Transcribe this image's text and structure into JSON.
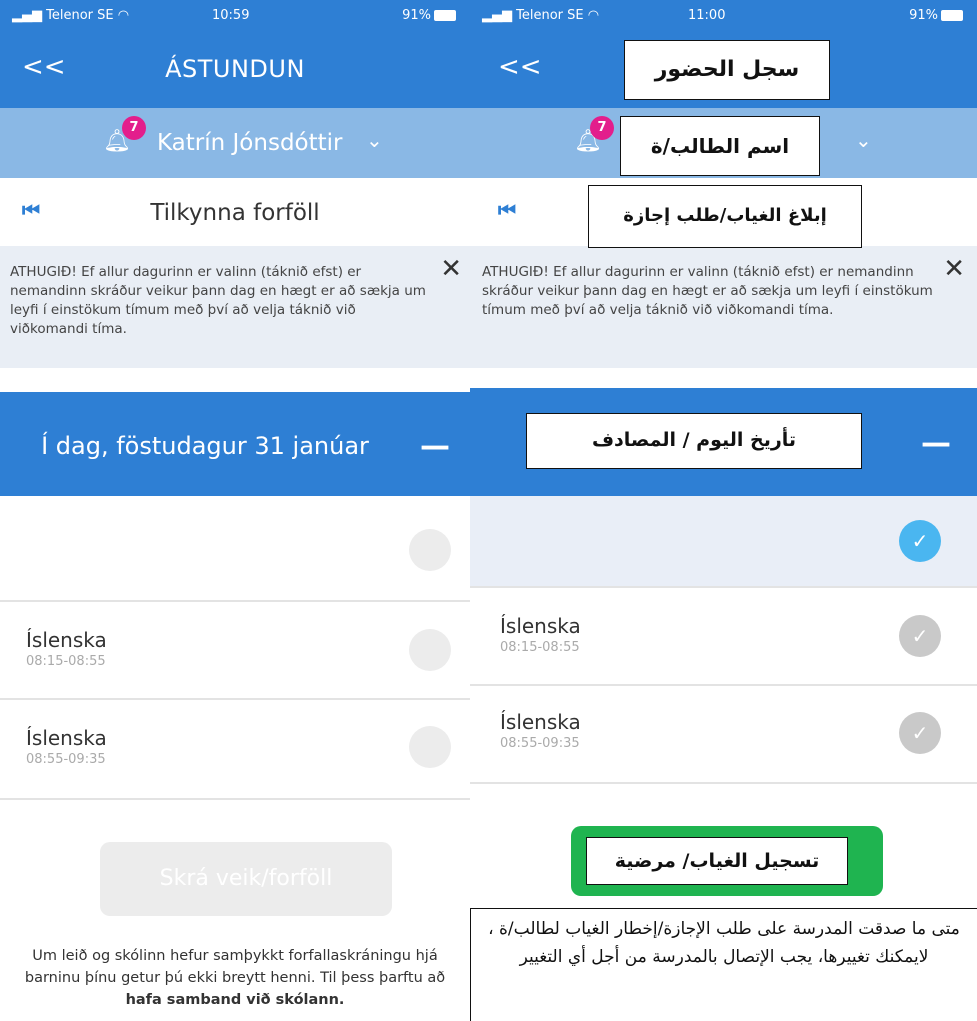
{
  "left": {
    "status": {
      "carrier": "Telenor SE",
      "time": "10:59",
      "battery": "91%"
    },
    "header": {
      "back": "<<",
      "title": "ÁSTUNDUN"
    },
    "student": {
      "badge": "7",
      "name": "Katrín Jónsdóttir"
    },
    "subheader": {
      "label": "Tilkynna forföll"
    },
    "notice": {
      "text": "ATHUGIÐ! Ef allur dagurinn er valinn (táknið efst) er nemandinn skráður veikur þann dag en hægt er að sækja um leyfi í einstökum tímum með því að velja táknið við viðkomandi tíma."
    },
    "date": "Í dag, föstudagur 31 janúar",
    "classes": [
      {
        "subject": "Íslenska",
        "time": "08:15-08:55"
      },
      {
        "subject": "Íslenska",
        "time": "08:55-09:35"
      }
    ],
    "register_button": "Skrá veik/forföll",
    "footer": {
      "text": "Um leið og skólinn hefur samþykkt forfallaskráningu hjá barninu þínu getur þú ekki breytt henni. Til þess þarftu að ",
      "bold": "hafa samband við skólann."
    }
  },
  "right": {
    "status": {
      "carrier": "Telenor SE",
      "time": "11:00",
      "battery": "91%"
    },
    "header": {
      "back": "<<"
    },
    "student": {
      "badge": "7"
    },
    "notice": {
      "text": "ATHUGIÐ! Ef allur dagurinn er valinn (táknið efst) er nemandinn skráður veikur þann dag en hægt er að sækja um leyfi í einstökum tímum með því að velja táknið við viðkomandi tíma."
    },
    "classes": [
      {
        "subject": "Íslenska",
        "time": "08:15-08:55"
      },
      {
        "subject": "Íslenska",
        "time": "08:55-09:35"
      }
    ],
    "annotations": {
      "attendance": "سجل الحضور",
      "student_name": "اسم الطالب/ة",
      "report": "إبلاغ الغياب/طلب إجازة",
      "date": "تأريخ اليوم / المصادف",
      "register": "تسجيل الغياب/ مرضية",
      "footer": "متى ما صدقت المدرسة على طلب الإجازة/إخطار الغياب لطالب/ة ، لايمكنك تغييرها، يجب الإتصال بالمدرسة من أجل أي التغيير"
    }
  }
}
